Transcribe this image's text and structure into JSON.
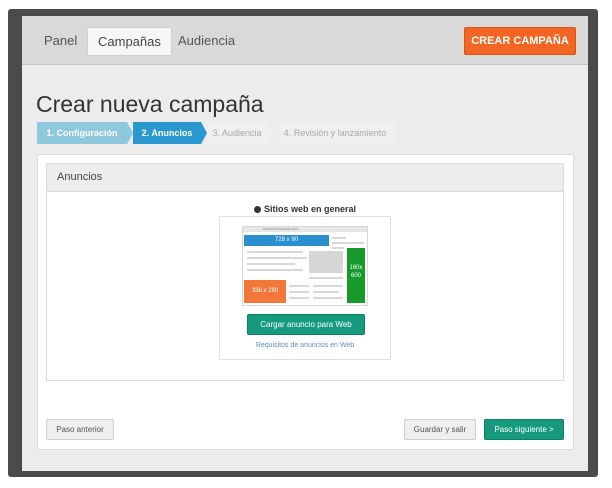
{
  "nav": {
    "items": [
      {
        "label": "Panel"
      },
      {
        "label": "Campañas"
      },
      {
        "label": "Audiencia"
      }
    ],
    "create_button": "CREAR CAMPAÑA"
  },
  "page": {
    "title": "Crear nueva campaña"
  },
  "steps": [
    {
      "label": "1. Configuración",
      "state": "done"
    },
    {
      "label": "2. Anuncios",
      "state": "current"
    },
    {
      "label": "3. Audiencia",
      "state": "todo"
    },
    {
      "label": "4. Revisión y lanzamiento",
      "state": "todo"
    }
  ],
  "ads_panel": {
    "heading": "Anuncios",
    "channel": "Sitios web en general",
    "mock": {
      "url": "www.webname.com",
      "ad_top": "728 x 90",
      "ad_side_w": "160x",
      "ad_side_h": "600",
      "ad_box": "336 x 280"
    },
    "upload_button": "Cargar anuncio para Web",
    "requirements_link": "Requisitos de anuncios en Web"
  },
  "footer": {
    "back_button": "Paso anterior",
    "save_button": "Guardar y salir",
    "next_button": "Paso siguiente >"
  },
  "colors": {
    "brand_orange": "#f26522",
    "step_current": "#2b97cf",
    "step_done": "#8ec8dc",
    "primary_green": "#169a7e",
    "ad_blue": "#2a8fd0",
    "ad_green": "#169a2a",
    "ad_orange": "#f4773a"
  }
}
